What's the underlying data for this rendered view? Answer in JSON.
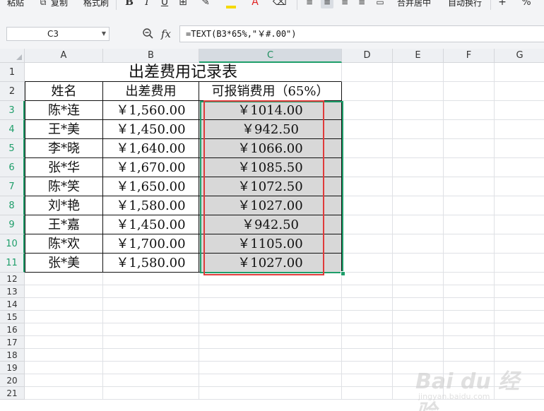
{
  "ribbon": {
    "paste": "粘贴",
    "copy": "复制",
    "format_painter": "格式刷",
    "bold": "B",
    "italic": "I",
    "underline": "U",
    "merge_center": "合并居中",
    "wrap_text": "自动换行",
    "plus": "+",
    "percent": "%"
  },
  "formula_bar": {
    "cell_ref": "C3",
    "fx_label": "fx",
    "formula": "=TEXT(B3*65%,\"￥#.00\")"
  },
  "columns": [
    "A",
    "B",
    "C",
    "D",
    "E",
    "F",
    "G"
  ],
  "rows": [
    "1",
    "2",
    "3",
    "4",
    "5",
    "6",
    "7",
    "8",
    "9",
    "10",
    "11",
    "12",
    "13",
    "14",
    "15",
    "16",
    "17",
    "18",
    "19",
    "20",
    "21"
  ],
  "sheet": {
    "title": "出差费用记录表",
    "headers": [
      "姓名",
      "出差费用",
      "可报销费用（65%）"
    ],
    "records": [
      {
        "name": "陈*连",
        "cost": "￥1,560.00",
        "reimb": "￥1014.00"
      },
      {
        "name": "王*美",
        "cost": "￥1,450.00",
        "reimb": "￥942.50"
      },
      {
        "name": "李*晓",
        "cost": "￥1,640.00",
        "reimb": "￥1066.00"
      },
      {
        "name": "张*华",
        "cost": "￥1,670.00",
        "reimb": "￥1085.50"
      },
      {
        "name": "陈*笑",
        "cost": "￥1,650.00",
        "reimb": "￥1072.50"
      },
      {
        "name": "刘*艳",
        "cost": "￥1,580.00",
        "reimb": "￥1027.00"
      },
      {
        "name": "王*嘉",
        "cost": "￥1,450.00",
        "reimb": "￥942.50"
      },
      {
        "name": "陈*欢",
        "cost": "￥1,700.00",
        "reimb": "￥1105.00"
      },
      {
        "name": "张*美",
        "cost": "￥1,580.00",
        "reimb": "￥1027.00"
      }
    ]
  },
  "colors": {
    "selection": "#1e9e6a",
    "highlight_box": "#e03b3b",
    "selected_fill": "#d8d8d8"
  },
  "watermark": {
    "text": "Bai du 经验",
    "sub": "jingyan.baidu.com"
  }
}
